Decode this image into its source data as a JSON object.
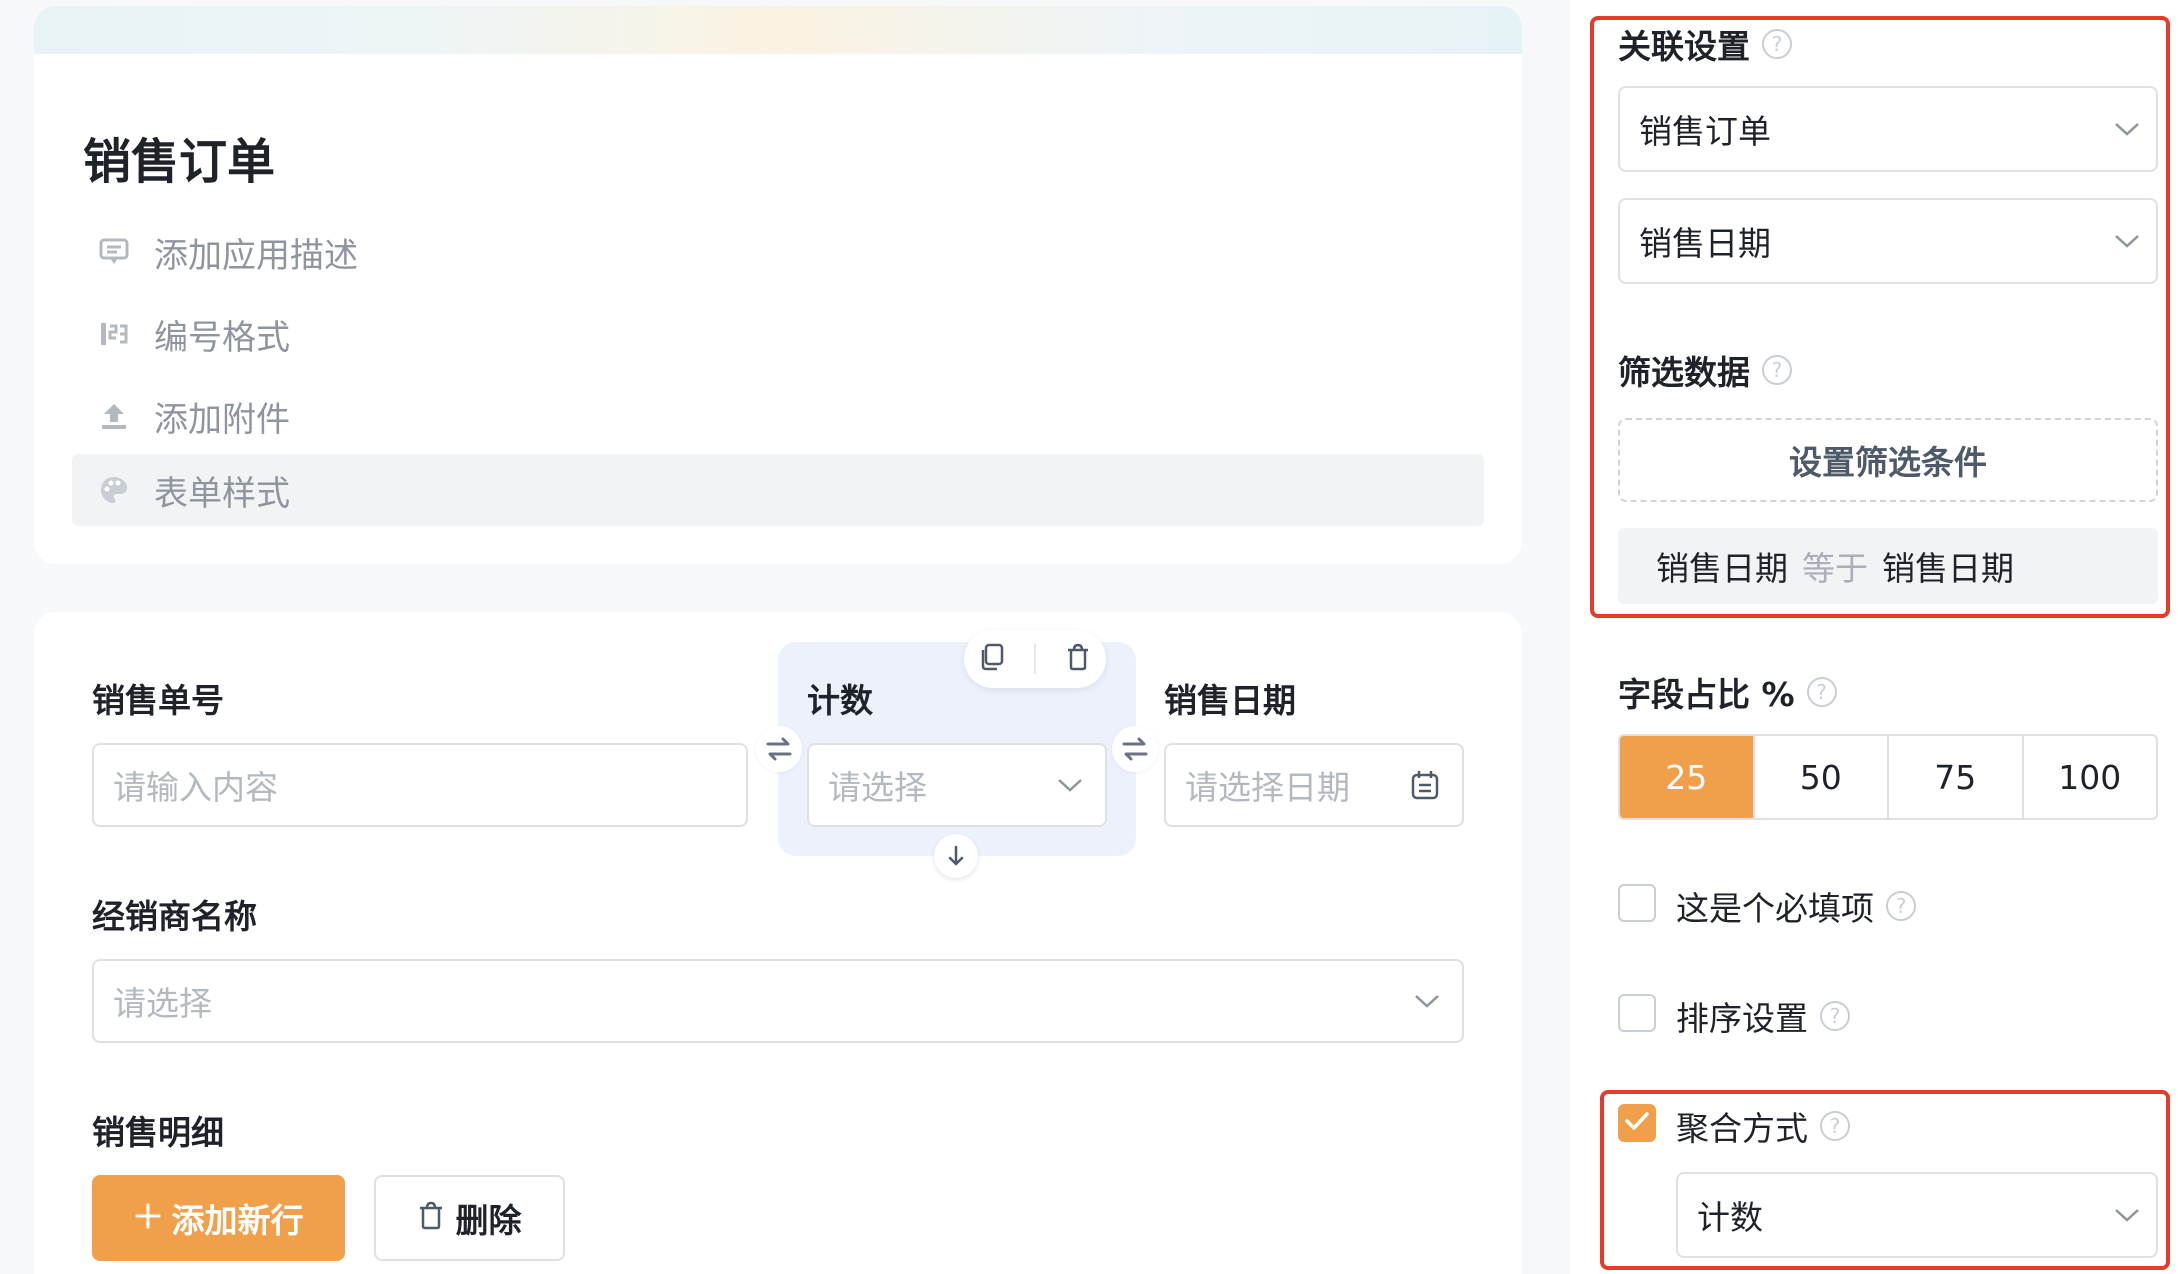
{
  "colors": {
    "accent": "#f0a04b",
    "highlight_box": "#e53b2b",
    "selected_field_bg": "#edf1fc"
  },
  "app": {
    "title": "销售订单",
    "menu": [
      {
        "label": "添加应用描述",
        "icon": "comment-icon"
      },
      {
        "label": "编号格式",
        "icon": "number-format-icon"
      },
      {
        "label": "添加附件",
        "icon": "upload-icon"
      },
      {
        "label": "表单样式",
        "icon": "palette-icon"
      }
    ]
  },
  "form": {
    "fields": {
      "order_no": {
        "label": "销售单号",
        "placeholder": "请输入内容"
      },
      "count": {
        "label": "计数",
        "placeholder": "请选择"
      },
      "sale_date": {
        "label": "销售日期",
        "placeholder": "请选择日期"
      },
      "dealer": {
        "label": "经销商名称",
        "placeholder": "请选择"
      },
      "detail": {
        "label": "销售明细"
      }
    },
    "buttons": {
      "add_row": "添加新行",
      "delete": "删除"
    }
  },
  "settings": {
    "relation": {
      "label": "关联设置",
      "form_select": "销售订单",
      "field_select": "销售日期"
    },
    "filter": {
      "label": "筛选数据",
      "button": "设置筛选条件",
      "condition": {
        "left": "销售日期",
        "op": "等于",
        "right": "销售日期"
      }
    },
    "ratio": {
      "label": "字段占比 %",
      "options": [
        "25",
        "50",
        "75",
        "100"
      ],
      "selected": "25"
    },
    "required": {
      "label": "这是个必填项",
      "checked": false
    },
    "sort": {
      "label": "排序设置",
      "checked": false
    },
    "aggregate": {
      "label": "聚合方式",
      "checked": true,
      "value": "计数"
    }
  }
}
